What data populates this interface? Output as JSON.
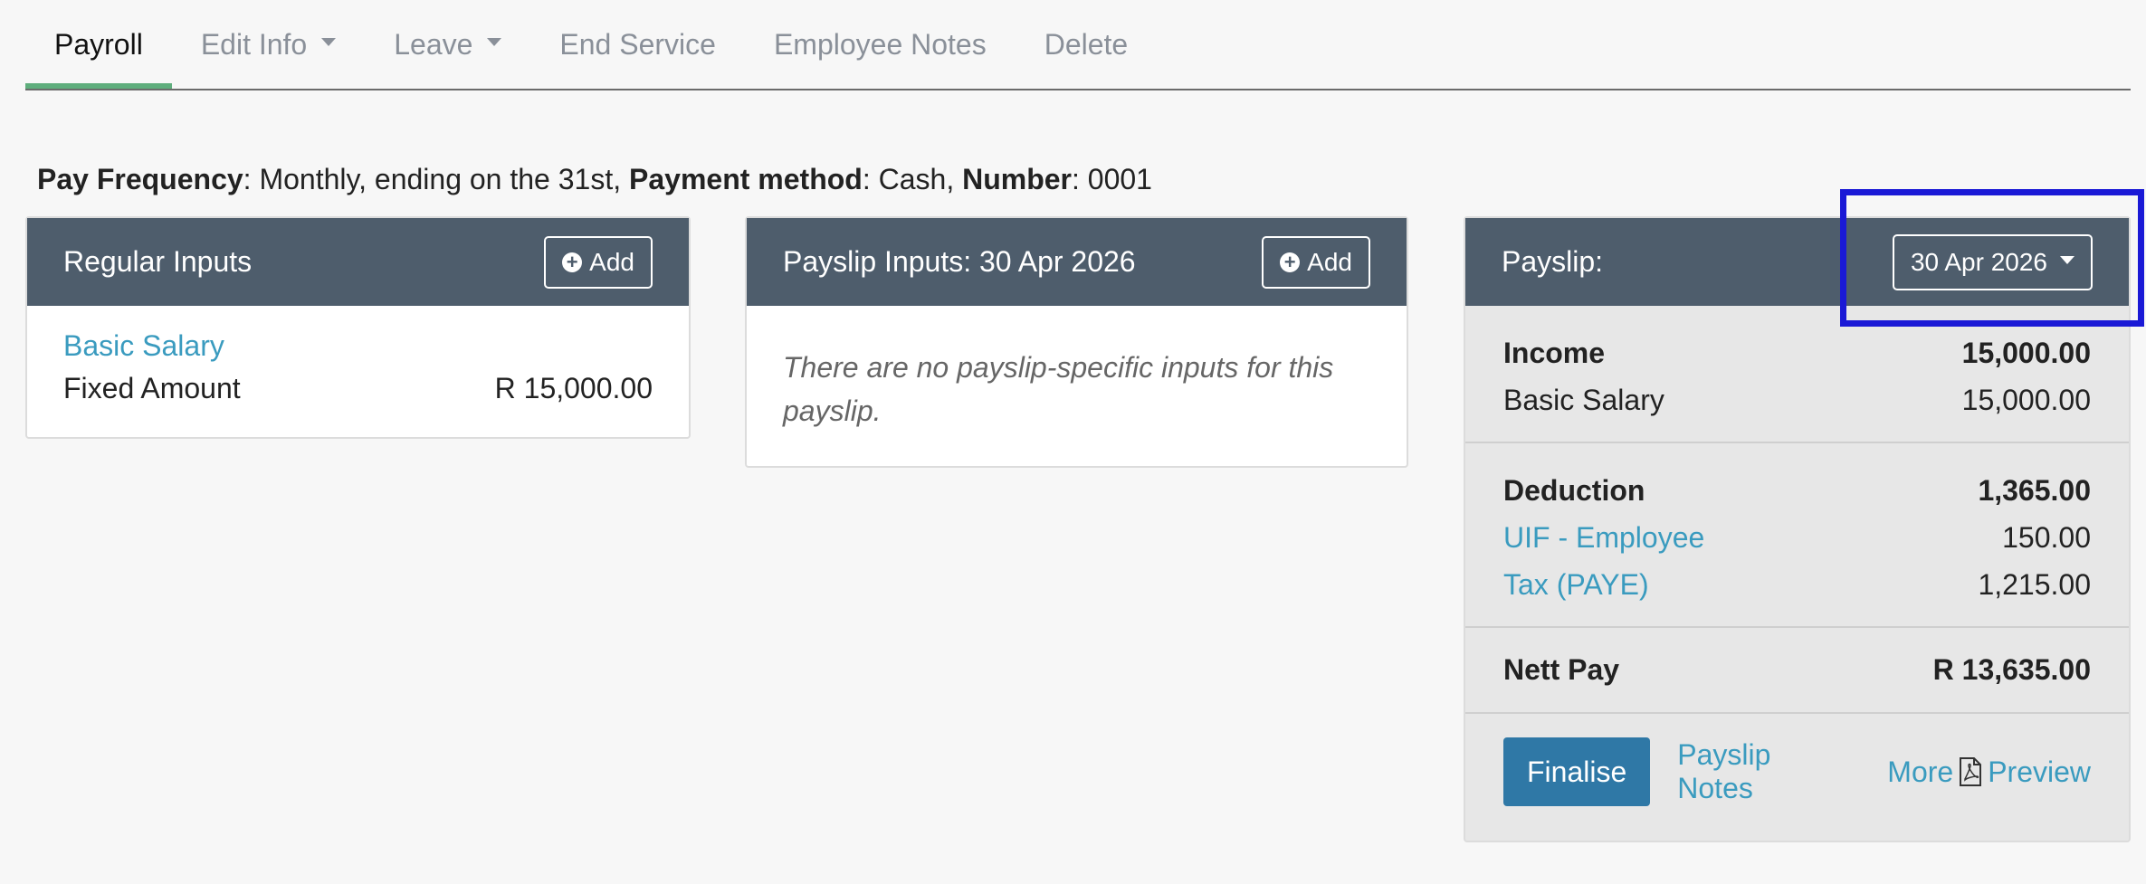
{
  "tabs": [
    {
      "label": "Payroll",
      "active": true
    },
    {
      "label": "Edit Info",
      "dropdown": true
    },
    {
      "label": "Leave",
      "dropdown": true
    },
    {
      "label": "End Service"
    },
    {
      "label": "Employee Notes"
    },
    {
      "label": "Delete"
    }
  ],
  "info": {
    "frequency_label": "Pay Frequency",
    "frequency_value": ": Monthly, ending on the 31st, ",
    "method_label": "Payment method",
    "method_value": ": Cash, ",
    "number_label": "Number",
    "number_value": ": 0001"
  },
  "regular_inputs": {
    "title": "Regular Inputs",
    "add_label": "Add",
    "item_link": "Basic Salary",
    "item_type": "Fixed Amount",
    "item_amount": "R 15,000.00"
  },
  "payslip_inputs": {
    "title": "Payslip Inputs: 30 Apr 2026",
    "add_label": "Add",
    "empty_message": "There are no payslip-specific inputs for this payslip."
  },
  "payslip": {
    "title": "Payslip:",
    "date": "30 Apr 2026",
    "income_label": "Income",
    "income_total": "15,000.00",
    "basic_label": "Basic Salary",
    "basic_amount": "15,000.00",
    "deduction_label": "Deduction",
    "deduction_total": "1,365.00",
    "uif_label": "UIF - Employee",
    "uif_amount": "150.00",
    "tax_label": "Tax (PAYE)",
    "tax_amount": "1,215.00",
    "nett_label": "Nett Pay",
    "nett_amount": "R 13,635.00",
    "finalise_label": "Finalise",
    "notes_label": "Payslip Notes",
    "more_label": "More",
    "preview_label": "Preview"
  },
  "colors": {
    "header_bg": "#4e5d6c",
    "link": "#3a9bbf",
    "primary": "#2f78a6",
    "active_tab_underline": "#5fae7d",
    "highlight": "#1a19d6"
  }
}
